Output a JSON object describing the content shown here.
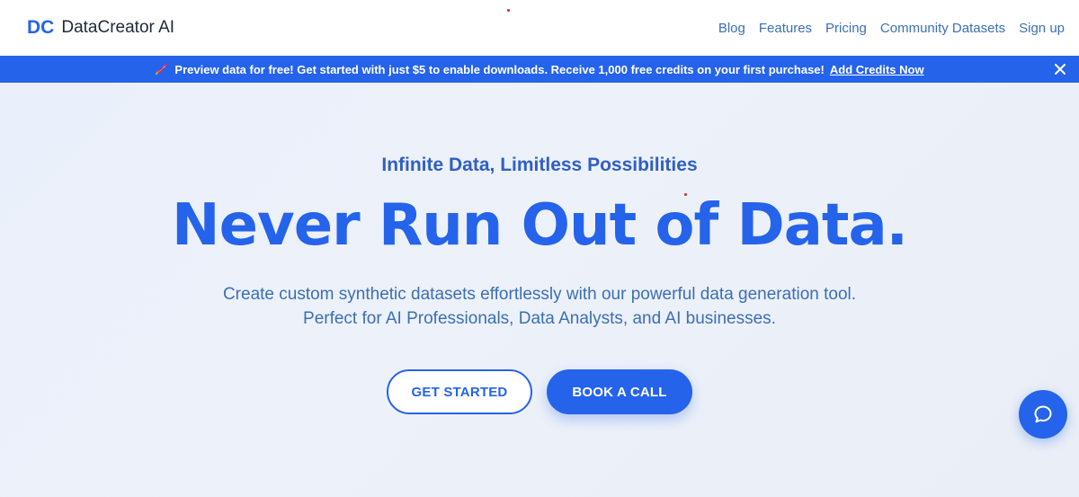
{
  "brand": {
    "mark": "DC",
    "name": "DataCreator AI"
  },
  "nav": {
    "items": [
      {
        "label": "Blog"
      },
      {
        "label": "Features"
      },
      {
        "label": "Pricing"
      },
      {
        "label": "Community Datasets"
      },
      {
        "label": "Sign up"
      }
    ]
  },
  "banner": {
    "icon": "rocket-icon",
    "text": "Preview data for free! Get started with just $5 to enable downloads. Receive 1,000 free credits on your first purchase!",
    "link_label": "Add Credits Now",
    "close_icon": "close-icon"
  },
  "hero": {
    "kicker": "Infinite Data, Limitless Possibilities",
    "title": "Never Run Out of Data.",
    "subtitle_line1": "Create custom synthetic datasets effortlessly with our powerful data generation tool.",
    "subtitle_line2": "Perfect for AI Professionals, Data Analysts, and AI businesses.",
    "primary_button": "GET STARTED",
    "secondary_button": "BOOK A CALL"
  },
  "chat": {
    "icon": "chat-bubble-icon"
  },
  "colors": {
    "accent": "#2563eb",
    "nav_link": "#3b6fb6",
    "hero_bg": "#eaf0fb"
  }
}
